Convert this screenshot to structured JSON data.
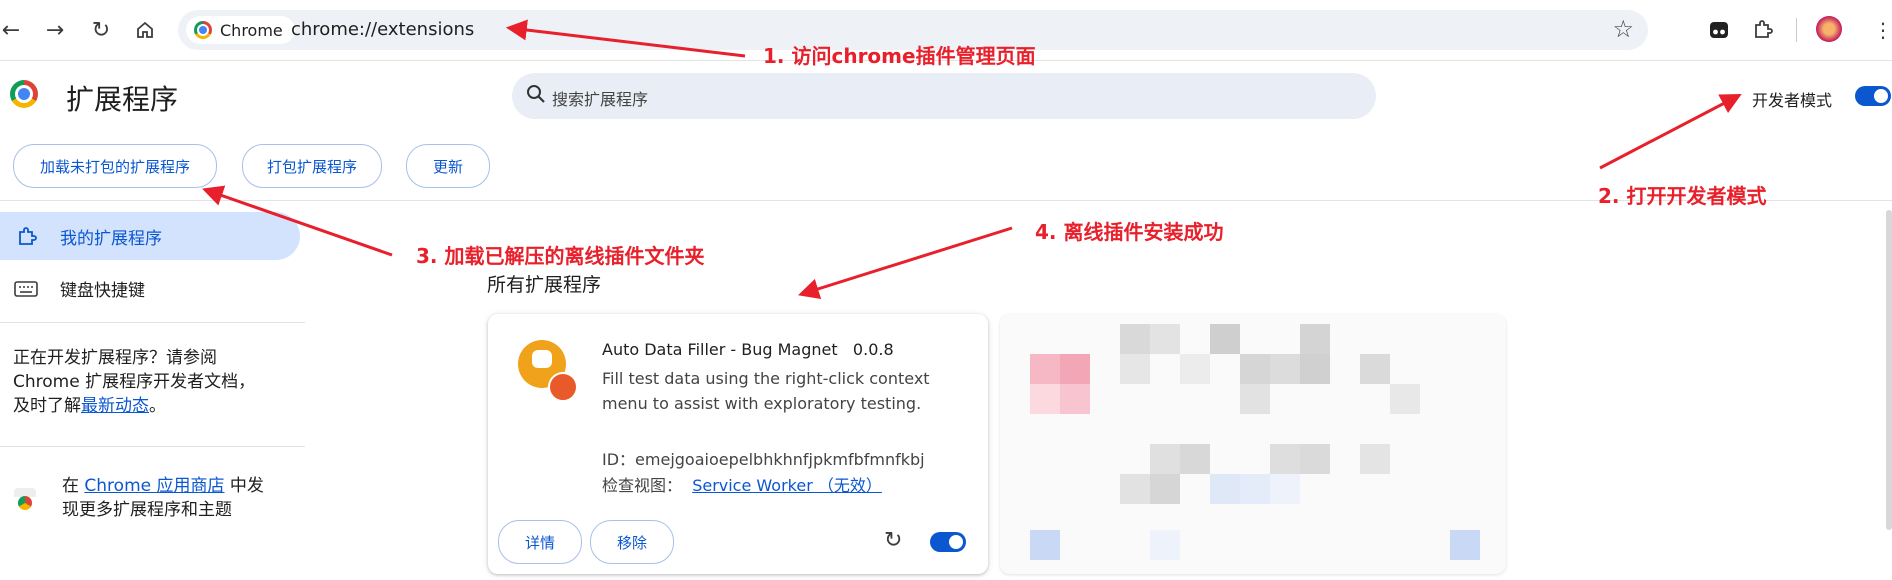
{
  "browser": {
    "chip_label": "Chrome",
    "url": "chrome://extensions"
  },
  "page": {
    "title": "扩展程序",
    "search_placeholder": "搜索扩展程序",
    "dev_mode_label": "开发者模式",
    "dev_mode_on": true
  },
  "actions": {
    "load_unpacked": "加载未打包的扩展程序",
    "pack": "打包扩展程序",
    "update": "更新"
  },
  "sidebar": {
    "items": [
      {
        "label": "我的扩展程序",
        "active": true
      },
      {
        "label": "键盘快捷键",
        "active": false
      }
    ],
    "dev_note_prefix": "正在开发扩展程序？请参阅",
    "dev_note_line2": "Chrome 扩展程序开发者文档，",
    "dev_note_line3_prefix": "及时了解",
    "dev_note_link": "最新动态",
    "dev_note_suffix": "。",
    "store_prefix": "在",
    "store_link": "Chrome 应用商店",
    "store_suffix": "中发",
    "store_line2": "现更多扩展程序和主题"
  },
  "extensions": {
    "section_title": "所有扩展程序",
    "items": [
      {
        "name": "Auto Data Filler - Bug Magnet",
        "version": "0.0.8",
        "description": "Fill test data using the right-click context menu to assist with exploratory testing.",
        "id_label": "ID：",
        "id": "emejgoaioepelbhkhnfjpkmfbfmnfkbj",
        "views_label": "检查视图：",
        "views_link": "Service Worker （无效）",
        "details_label": "详情",
        "remove_label": "移除",
        "enabled": true
      }
    ]
  },
  "annotations": {
    "step1": "1. 访问chrome插件管理页面",
    "step2": "2. 打开开发者模式",
    "step3": "3. 加载已解压的离线插件文件夹",
    "step4": "4. 离线插件安装成功",
    "color": "#e8202b"
  },
  "colors": {
    "accent": "#0b57d0",
    "sidebar_active": "#d3e3fd"
  }
}
